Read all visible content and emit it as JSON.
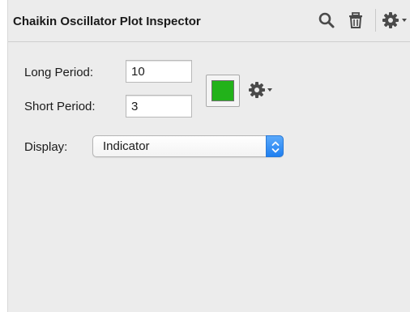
{
  "header": {
    "title": "Chaikin Oscillator Plot Inspector",
    "icons": [
      "search-icon",
      "trash-icon",
      "gear-icon",
      "chevron-down-icon"
    ]
  },
  "form": {
    "long_period_label": "Long Period:",
    "long_period_value": "10",
    "short_period_label": "Short Period:",
    "short_period_value": "3",
    "display_label": "Display:",
    "display_value": "Indicator"
  },
  "colors": {
    "plot_color": "#22b21a",
    "accent": "#2d86f5"
  }
}
